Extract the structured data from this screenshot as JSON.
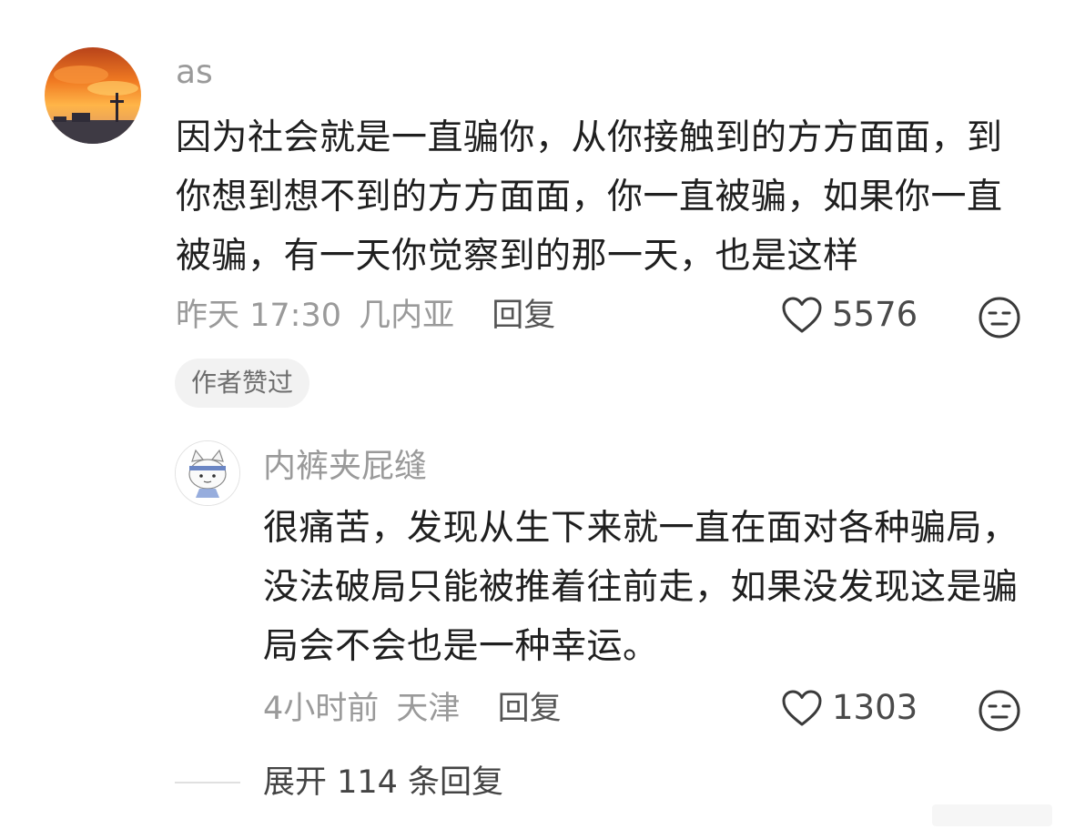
{
  "comment": {
    "username": "as",
    "text": "因为社会就是一直骗你，从你接触到的方方面面，到你想到想不到的方方面面，你一直被骗，如果你一直被骗，有一天你觉察到的那一天，也是这样",
    "time": "昨天 17:30",
    "location": "几内亚",
    "reply_label": "回复",
    "likes": "5576",
    "author_badge": "作者赞过",
    "icons": {
      "like": "heart-outline-icon",
      "dislike": "meh-face-icon"
    }
  },
  "reply": {
    "username": "内裤夹屁缝",
    "text": "很痛苦，发现从生下来就一直在面对各种骗局，没法破局只能被推着往前走，如果没发现这是骗局会不会也是一种幸运。",
    "time": "4小时前",
    "location": "天津",
    "reply_label": "回复",
    "likes": "1303"
  },
  "expand": {
    "text": "展开 114 条回复"
  },
  "colors": {
    "text_primary": "#1f1f1f",
    "text_secondary": "#9a9a9a",
    "badge_bg": "#f2f2f2"
  }
}
